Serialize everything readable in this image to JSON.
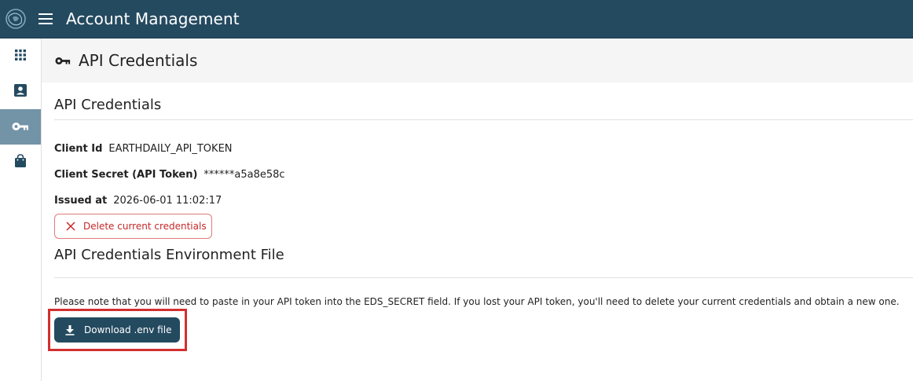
{
  "topbar": {
    "app_title": "Account Management",
    "logo_icon": "globe-logo-icon",
    "menu_icon": "hamburger-menu-icon",
    "background": "#244a60"
  },
  "sidebar": {
    "items": [
      {
        "icon": "apps-grid-icon",
        "active": false
      },
      {
        "icon": "account-box-icon",
        "active": false
      },
      {
        "icon": "key-icon",
        "active": true
      },
      {
        "icon": "shopping-bag-icon",
        "active": false
      }
    ],
    "active_color": "#7393a7"
  },
  "page_header": {
    "title": "API Credentials",
    "icon": "key-icon"
  },
  "credentials": {
    "section_title": "API Credentials",
    "client_id_label": "Client Id",
    "client_id_value": "EARTHDAILY_API_TOKEN",
    "client_secret_label": "Client Secret (API Token)",
    "client_secret_value": "******a5a8e58c",
    "issued_at_label": "Issued at",
    "issued_at_value": "2026-06-01 11:02:17",
    "delete_button_label": "Delete current credentials",
    "delete_color": "#c62828"
  },
  "env_file": {
    "section_title": "API Credentials Environment File",
    "note": "Please note that you will need to paste in your API token into the EDS_SECRET field. If you lost your API token, you'll need to delete your current credentials and obtain a new one.",
    "download_button_label": "Download .env file",
    "highlight_color": "#d32f2f"
  }
}
